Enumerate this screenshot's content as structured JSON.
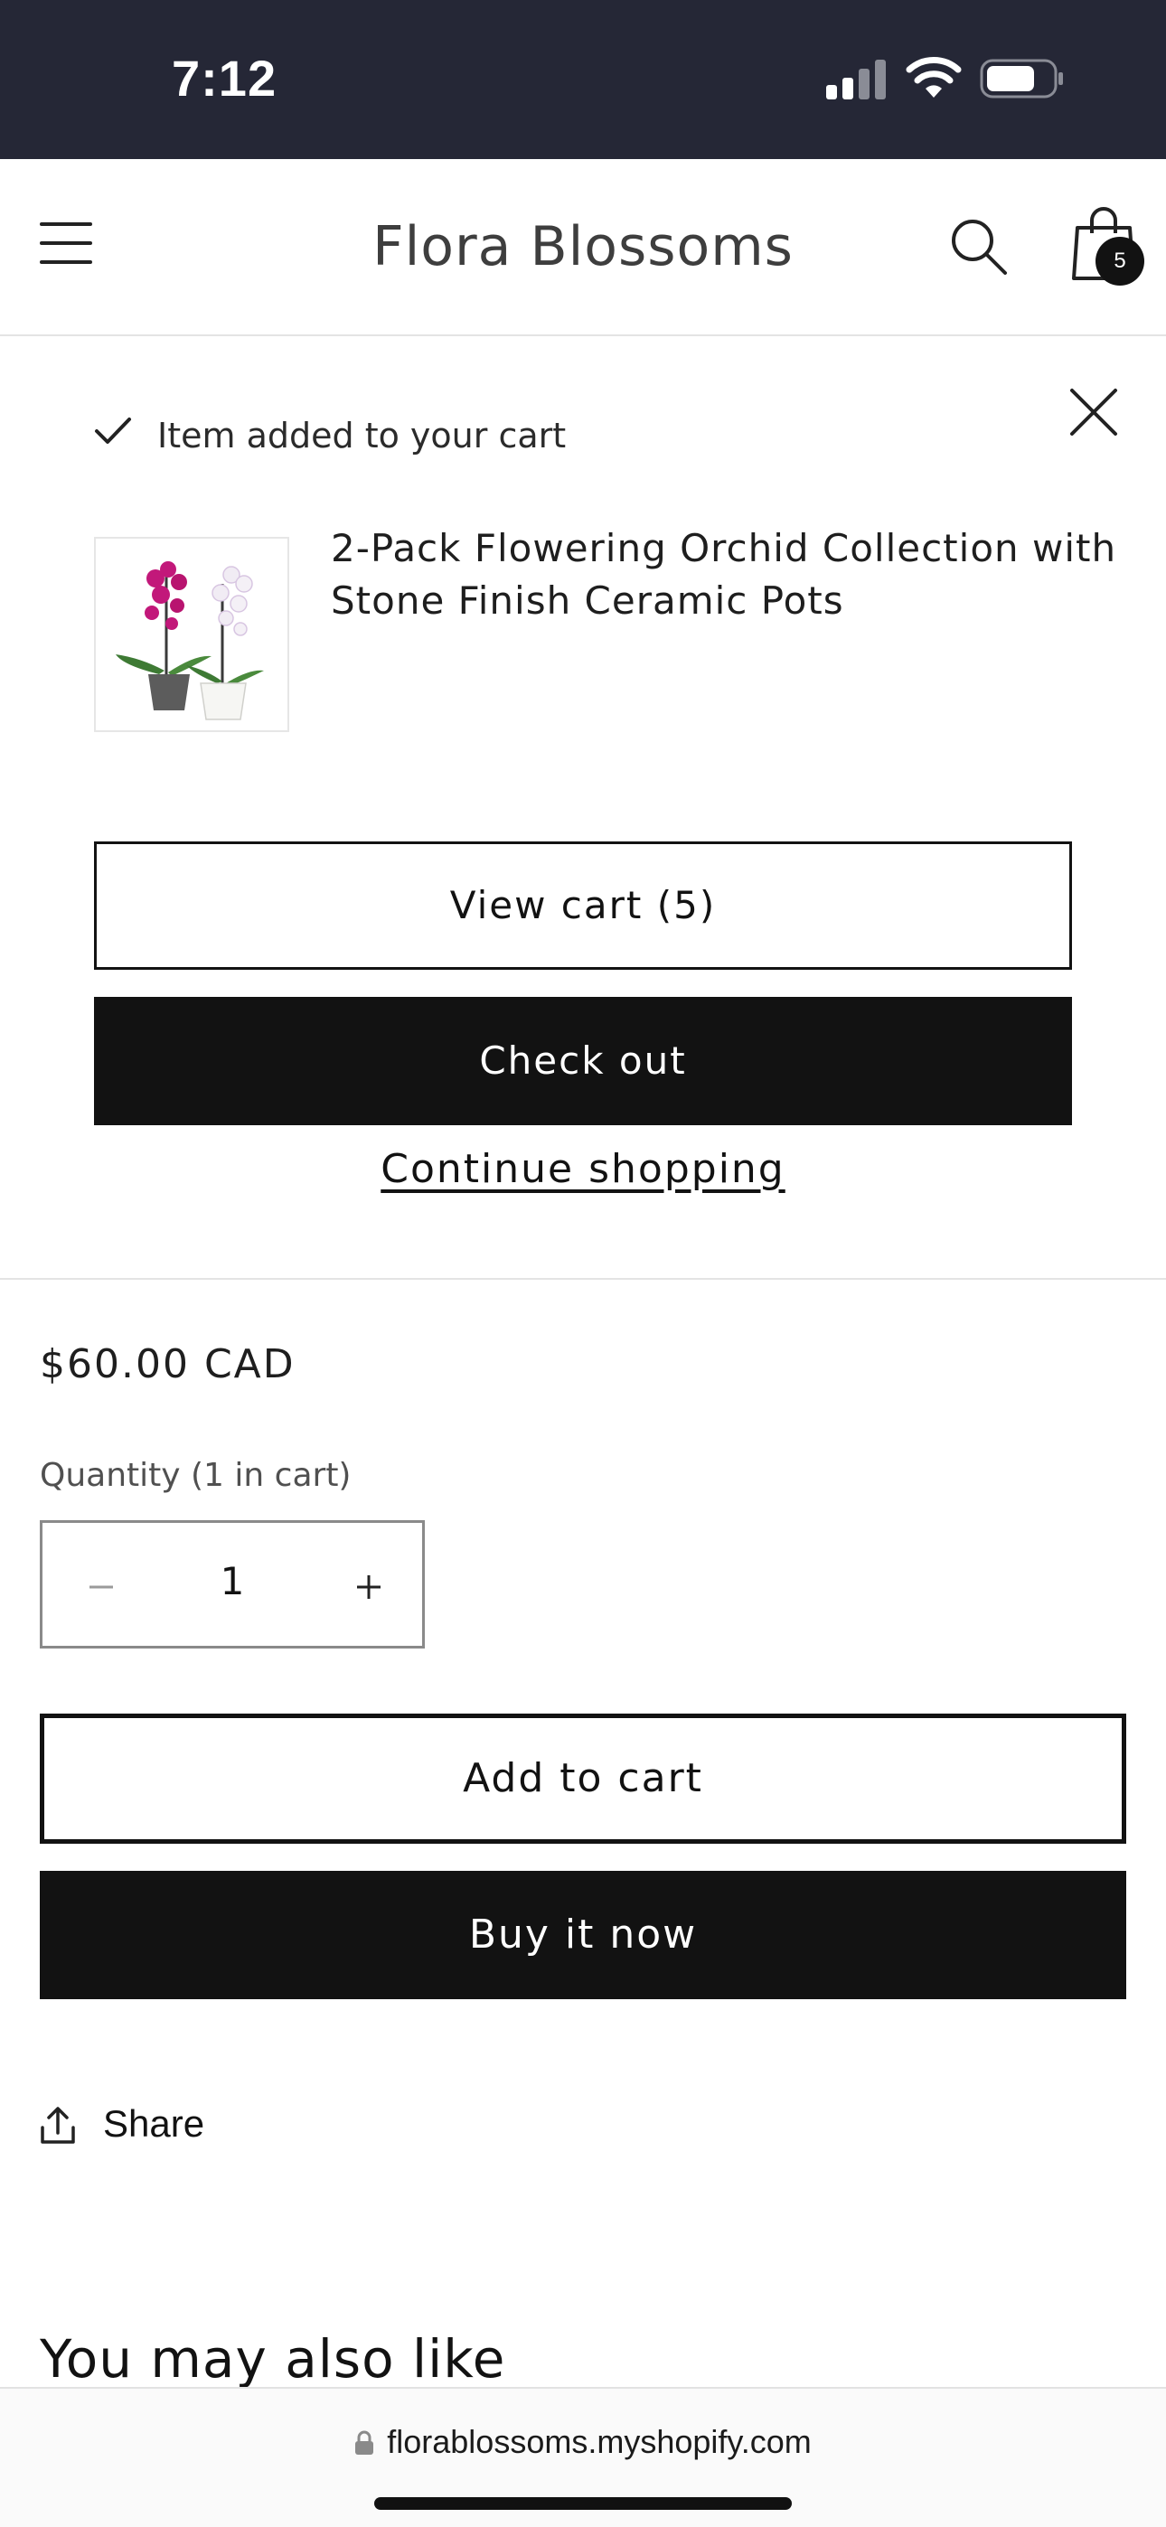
{
  "status_bar": {
    "time": "7:12",
    "icons": [
      "cellular-signal-icon",
      "wifi-icon",
      "battery-icon"
    ]
  },
  "header": {
    "store_name": "Flora Blossoms",
    "cart_count": "5",
    "icons": [
      "menu-icon",
      "search-icon",
      "shopping-bag-icon"
    ]
  },
  "notification": {
    "message": "Item added to your cart",
    "product_name": "2-Pack Flowering Orchid Collection with Stone Finish Ceramic Pots",
    "view_cart_label": "View cart (5)",
    "checkout_label": "Check out",
    "continue_label": "Continue shopping"
  },
  "product": {
    "price": "$60.00 CAD",
    "quantity_label": "Quantity (1 in cart)",
    "quantity_value": "1",
    "add_to_cart_label": "Add to cart",
    "buy_now_label": "Buy it now",
    "share_label": "Share",
    "recommendations_heading": "You may also like"
  },
  "browser": {
    "url": "florablossoms.myshopify.com"
  },
  "colors": {
    "status_bar_bg": "#252736",
    "primary_button": "#121212",
    "orchid_magenta": "#c2187a"
  }
}
